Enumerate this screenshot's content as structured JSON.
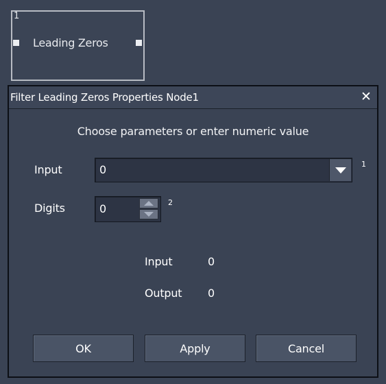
{
  "node": {
    "index": "1",
    "label": "Leading Zeros"
  },
  "dialog": {
    "title": "Filter Leading Zeros Properties Node1",
    "close_icon": "close-icon",
    "instruction": "Choose parameters or enter numeric value",
    "input": {
      "label": "Input",
      "value": "0",
      "superscript": "1"
    },
    "digits": {
      "label": "Digits",
      "value": "0",
      "superscript": "2"
    },
    "readouts": {
      "input_label": "Input",
      "input_value": "0",
      "output_label": "Output",
      "output_value": "0"
    },
    "buttons": {
      "ok": "OK",
      "apply": "Apply",
      "cancel": "Cancel"
    }
  },
  "colors": {
    "background": "#3a4354",
    "field_background": "#2d3444",
    "button_background": "#4a5466"
  }
}
